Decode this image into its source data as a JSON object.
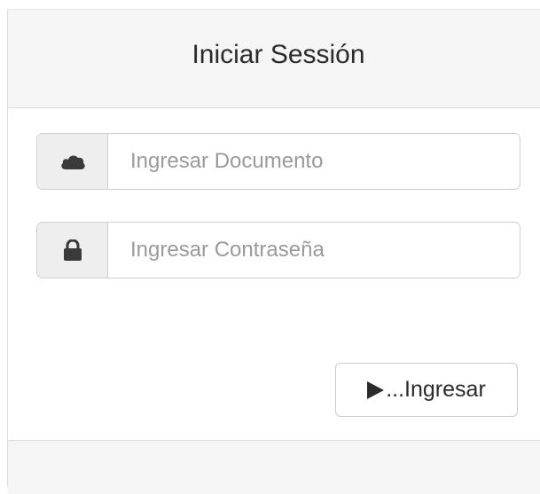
{
  "login": {
    "title": "Iniciar Sessión",
    "document_field": {
      "icon": "cloud-icon",
      "value": "",
      "placeholder": "Ingresar Documento"
    },
    "password_field": {
      "icon": "lock-icon",
      "value": "",
      "placeholder": "Ingresar Contraseña"
    },
    "submit": {
      "icon": "play-icon",
      "label": "...Ingresar"
    }
  },
  "colors": {
    "heading_bg": "#f5f5f5",
    "addon_bg": "#eeeeee",
    "border": "#cfcfcf",
    "text": "#2b2b2b",
    "placeholder": "#9a9a9a"
  }
}
